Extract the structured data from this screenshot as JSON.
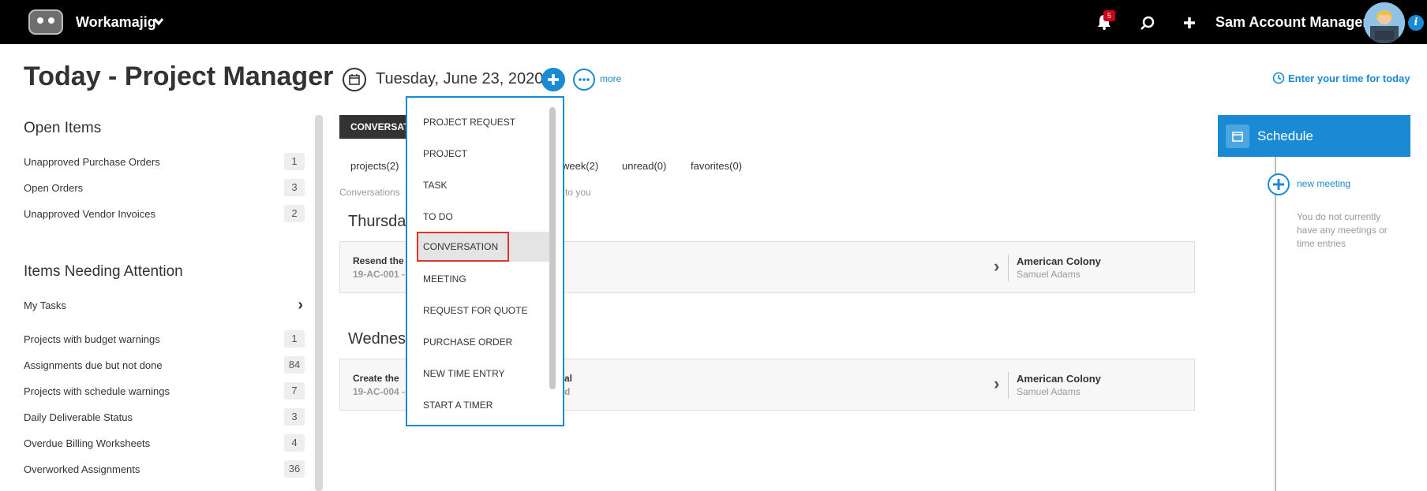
{
  "topbar": {
    "app_name": "Workamajig",
    "notification_count": "5",
    "user_name": "Sam Account Manager",
    "info_label": "i",
    "icons": [
      "logo-icon",
      "chevron-down-icon",
      "bell-icon",
      "search-icon",
      "plus-icon",
      "avatar",
      "info-icon"
    ]
  },
  "header": {
    "title": "Today - Project Manager",
    "date": "Tuesday, June 23, 2020",
    "more_label": "more",
    "time_link": "Enter your time for today"
  },
  "open_items": {
    "title": "Open Items",
    "rows": [
      {
        "label": "Unapproved Purchase Orders",
        "count": "1"
      },
      {
        "label": "Open Orders",
        "count": "3"
      },
      {
        "label": "Unapproved Vendor Invoices",
        "count": "2"
      }
    ]
  },
  "attention": {
    "title": "Items Needing Attention",
    "my_tasks": "My Tasks",
    "rows": [
      {
        "label": "Projects with budget warnings",
        "count": "1"
      },
      {
        "label": "Assignments due but not done",
        "count": "84"
      },
      {
        "label": "Projects with schedule warnings",
        "count": "7"
      },
      {
        "label": "Daily Deliverable Status",
        "count": "3"
      },
      {
        "label": "Overdue Billing Worksheets",
        "count": "4"
      },
      {
        "label": "Overworked Assignments",
        "count": "36"
      }
    ]
  },
  "conversations": {
    "tab_label": "CONVERSATI",
    "filters": [
      "projects(2)",
      "week(2)",
      "unread(0)",
      "favorites(0)"
    ],
    "note_left": "Conversations",
    "note_right": "to you",
    "days": [
      {
        "heading": "Thursday",
        "card": {
          "line1": "Resend the",
          "line2": "19-AC-001 -",
          "mid1": "",
          "mid2": "",
          "client": "American Colony",
          "person": "Samuel Adams"
        }
      },
      {
        "heading": "Wednesd",
        "card": {
          "line1": "Create the",
          "line2": "19-AC-004 -",
          "mid1": "al",
          "mid2": "d",
          "client": "American Colony",
          "person": "Samuel Adams"
        }
      }
    ]
  },
  "schedule": {
    "title": "Schedule",
    "new_meeting": "new meeting",
    "empty_text": "You do not currently have any meetings or time entries"
  },
  "add_menu": {
    "items": [
      "PROJECT REQUEST",
      "PROJECT",
      "TASK",
      "TO DO",
      "CONVERSATION",
      "MEETING",
      "REQUEST FOR QUOTE",
      "PURCHASE ORDER",
      "NEW TIME ENTRY",
      "START A TIMER"
    ],
    "selected_index": 4
  },
  "colors": {
    "accent": "#1a8ad4",
    "topbar": "#000000",
    "highlight_border": "#e3322b",
    "badge": "#d0021b"
  }
}
